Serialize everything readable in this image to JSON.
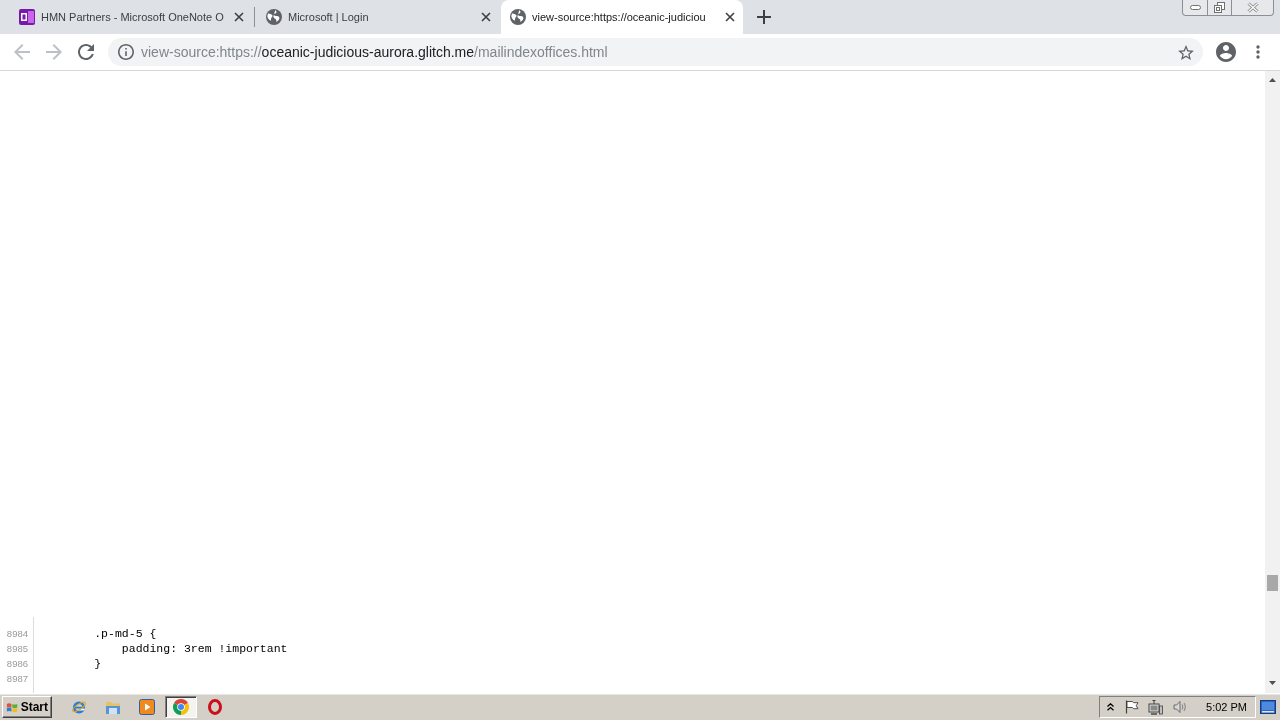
{
  "browser": {
    "tabs": [
      {
        "kind": "notebook",
        "title": "HMN Partners - Microsoft OneNote O",
        "selected": false
      },
      {
        "kind": "site",
        "title": "Microsoft | Login",
        "selected": false
      },
      {
        "kind": "site",
        "title": "view-source:https://oceanic-judiciou",
        "selected": true
      }
    ],
    "toolbar": [
      {
        "kind": "back",
        "disabled": true
      },
      {
        "kind": "forward",
        "disabled": true
      },
      {
        "kind": "reload",
        "disabled": false
      }
    ],
    "address_bar": {
      "scheme": "view-source:https://",
      "host": "oceanic-judicious-aurora.glitch.me",
      "path": "/mailindexoffices.html"
    }
  },
  "source_view": {
    "lines": [
      {
        "number": "8984",
        "code": "        .p-md-5 {"
      },
      {
        "number": "8985",
        "code": "            padding: 3rem !important"
      },
      {
        "number": "8986",
        "code": "        }"
      },
      {
        "number": "8987"
      }
    ]
  },
  "taskbar": {
    "start": "Start",
    "apps": [
      {
        "kind": "ie",
        "selected": false
      },
      {
        "kind": "explorer",
        "selected": false
      },
      {
        "kind": "player",
        "selected": false
      },
      {
        "kind": "chrome",
        "selected": true
      },
      {
        "kind": "opera",
        "selected": false
      }
    ],
    "clock": "5:02 PM"
  }
}
